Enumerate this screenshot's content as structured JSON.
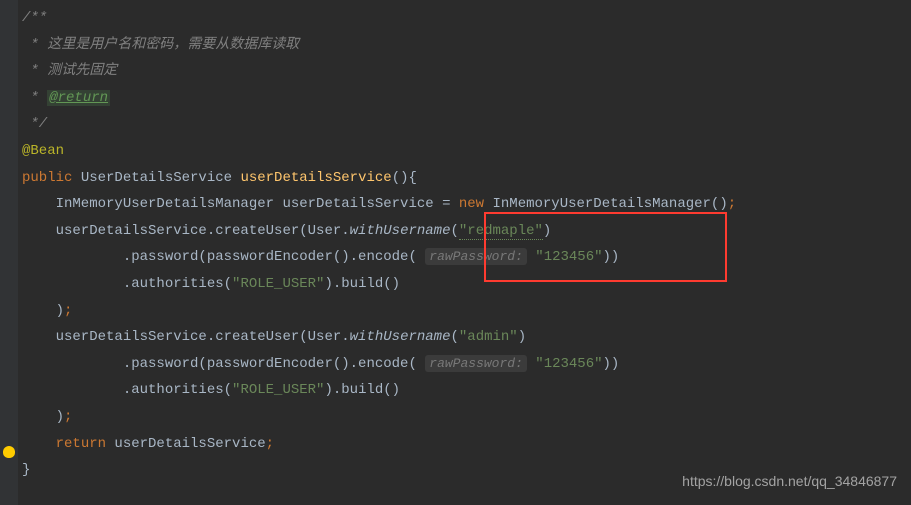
{
  "code": {
    "l1": "/**",
    "l2_prefix": " * ",
    "l2": "这里是用户名和密码，需要从数据库读取",
    "l3_prefix": " * ",
    "l3": "测试先固定",
    "l4_prefix": " * ",
    "l4_tag": "@return",
    "l5": " */",
    "l6": "@Bean",
    "l7_kw": "public ",
    "l7_type": "UserDetailsService ",
    "l7_name": "userDetailsService",
    "l7_rest": "(){",
    "l8_a": "    InMemoryUserDetailsManager userDetailsService = ",
    "l8_new": "new ",
    "l8_b": "InMemoryUserDetailsManager()",
    "l8_semi": ";",
    "l9_a": "    userDetailsService.createUser(User.",
    "l9_static": "withUsername",
    "l9_b": "(",
    "l9_str": "\"redmaple\"",
    "l9_c": ")",
    "l10_a": "            .password(passwordEncoder().encode( ",
    "l10_hint": "rawPassword:",
    "l10_sp": " ",
    "l10_str": "\"123456\"",
    "l10_b": "))",
    "l11_a": "            .authorities(",
    "l11_str": "\"ROLE_USER\"",
    "l11_b": ").build()",
    "l12": "    )",
    "l12_semi": ";",
    "l13_a": "    userDetailsService.createUser(User.",
    "l13_static": "withUsername",
    "l13_b": "(",
    "l13_str": "\"admin\"",
    "l13_c": ")",
    "l14_a": "            .password(passwordEncoder().encode( ",
    "l14_hint": "rawPassword:",
    "l14_sp": " ",
    "l14_str": "\"123456\"",
    "l14_b": "))",
    "l15_a": "            .authorities(",
    "l15_str": "\"ROLE_USER\"",
    "l15_b": ").build()",
    "l16": "    )",
    "l16_semi": ";",
    "l17_a": "    ",
    "l17_kw": "return ",
    "l17_b": "userDetailsService",
    "l17_semi": ";",
    "l18": "}"
  },
  "watermark": "https://blog.csdn.net/qq_34846877"
}
